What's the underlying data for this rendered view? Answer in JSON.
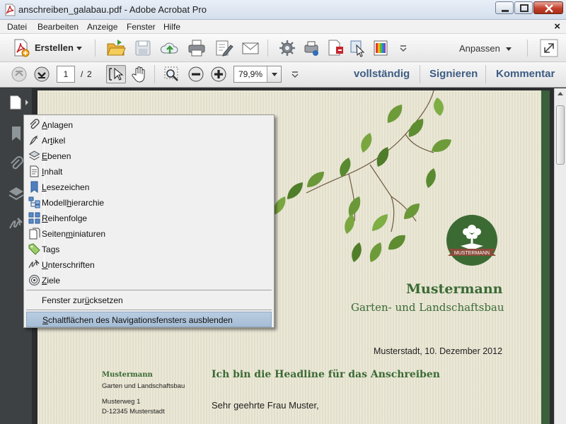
{
  "window": {
    "title": "anschreiben_galabau.pdf - Adobe Acrobat Pro"
  },
  "menubar": {
    "items": [
      "Datei",
      "Bearbeiten",
      "Anzeige",
      "Fenster",
      "Hilfe"
    ],
    "close_symbol": "×"
  },
  "toolbar1": {
    "create_label": "Erstellen",
    "customize_label": "Anpassen",
    "icons": [
      "create-pdf-icon",
      "open-folder-icon",
      "save-icon",
      "cloud-upload-icon",
      "print-icon",
      "edit-icon",
      "email-icon",
      "gear-icon",
      "share-icon",
      "pdf-export-icon",
      "cursor-tool-icon",
      "color-icon",
      "expand-icon"
    ]
  },
  "toolbar2": {
    "current_page": "1",
    "page_separator": "/",
    "total_pages": "2",
    "zoom": "79,9%",
    "links": [
      "vollständig",
      "Signieren",
      "Kommentar"
    ]
  },
  "navpane": {
    "icons": [
      "page-thumbnails-icon",
      "bookmark-icon",
      "attachment-icon",
      "layers-icon",
      "signature-icon"
    ]
  },
  "popup_menu": {
    "items": [
      {
        "pre": "",
        "u": "A",
        "post": "nlagen",
        "icon": "attachment-icon"
      },
      {
        "pre": "Ar",
        "u": "t",
        "post": "ikel",
        "icon": "article-icon"
      },
      {
        "pre": "",
        "u": "E",
        "post": "benen",
        "icon": "layers-icon"
      },
      {
        "pre": "",
        "u": "I",
        "post": "nhalt",
        "icon": "content-icon"
      },
      {
        "pre": "",
        "u": "L",
        "post": "esezeichen",
        "icon": "bookmark-icon"
      },
      {
        "pre": "Modell",
        "u": "h",
        "post": "ierarchie",
        "icon": "model-tree-icon"
      },
      {
        "pre": "",
        "u": "R",
        "post": "eihenfolge",
        "icon": "order-icon"
      },
      {
        "pre": "Seiten",
        "u": "m",
        "post": "iniaturen",
        "icon": "page-thumbnails-icon"
      },
      {
        "pre": "Ta",
        "u": "g",
        "post": "s",
        "icon": "tag-icon"
      },
      {
        "pre": "",
        "u": "U",
        "post": "nterschriften",
        "icon": "signature-icon"
      },
      {
        "pre": "",
        "u": "Z",
        "post": "iele",
        "icon": "destinations-icon"
      }
    ],
    "reset": {
      "pre": "Fenster zur",
      "u": "ü",
      "post": "cksetzen"
    },
    "hide": {
      "pre": "",
      "u": "S",
      "post": "chaltflächen des Navigationsfensters ausblenden"
    }
  },
  "document": {
    "logo_text": "MUSTERMANN",
    "brand_name": "Mustermann",
    "brand_subtitle": "Garten- und Landschaftsbau",
    "date_line": "Musterstadt, 10. Dezember 2012",
    "sender": {
      "name": "Mustermann",
      "subtitle": "Garten und Landschaftsbau",
      "street": "Musterweg 1",
      "city": "D-12345 Musterstadt"
    },
    "headline": "Ich bin die Headline für das Anschreiben",
    "salutation": "Sehr geehrte Frau Muster,"
  },
  "colors": {
    "brand_green": "#3a6a34",
    "link_blue": "#3d5c82",
    "menu_highlight": "#b9cde1"
  }
}
